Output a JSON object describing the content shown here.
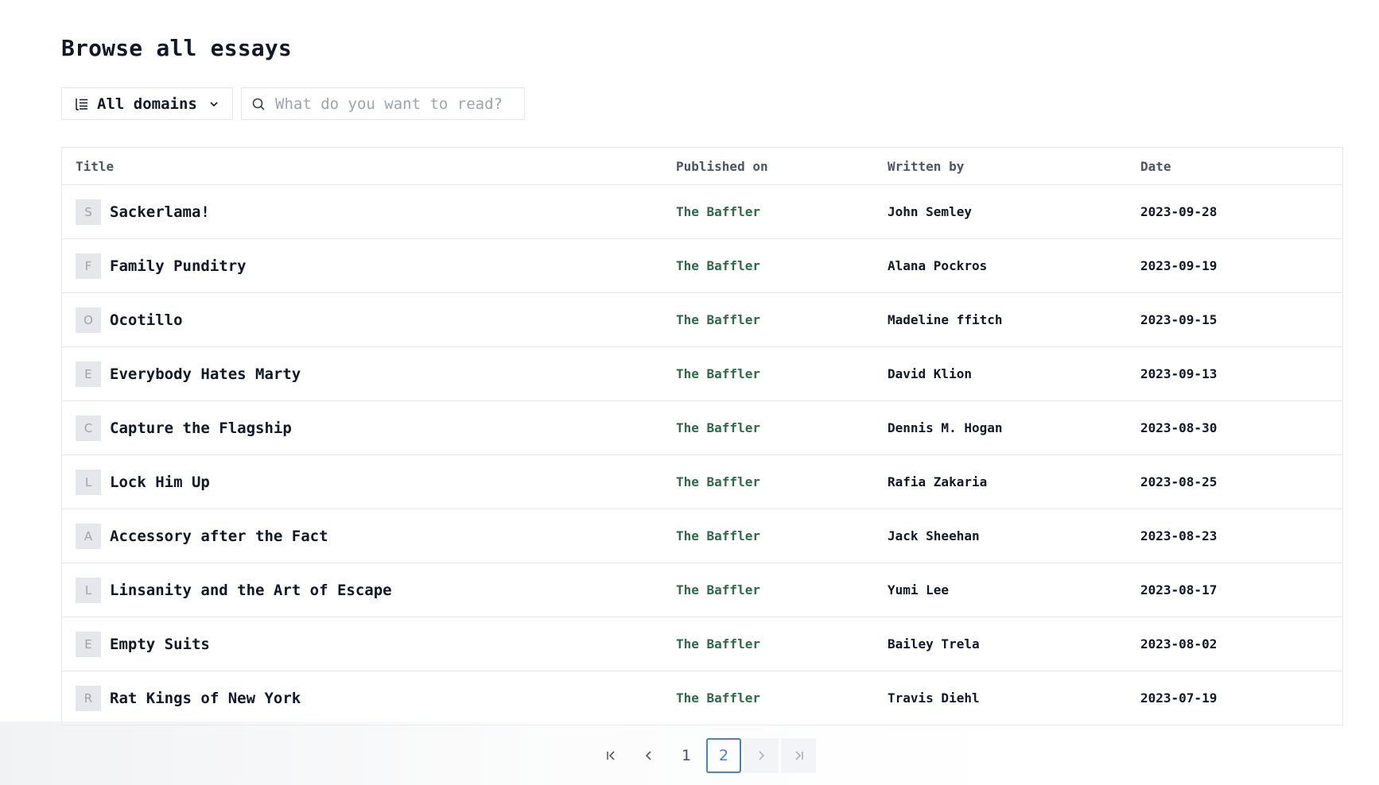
{
  "page": {
    "title": "Browse all essays"
  },
  "filters": {
    "domain_label": "All domains",
    "search_placeholder": "What do you want to read?",
    "search_value": ""
  },
  "table": {
    "columns": [
      "Title",
      "Published on",
      "Written by",
      "Date"
    ],
    "rows": [
      {
        "initial": "S",
        "title": "Sackerlama!",
        "published_on": "The Baffler",
        "author": "John Semley",
        "date": "2023-09-28"
      },
      {
        "initial": "F",
        "title": "Family Punditry",
        "published_on": "The Baffler",
        "author": "Alana Pockros",
        "date": "2023-09-19"
      },
      {
        "initial": "O",
        "title": "Ocotillo",
        "published_on": "The Baffler",
        "author": "Madeline ffitch",
        "date": "2023-09-15"
      },
      {
        "initial": "E",
        "title": "Everybody Hates Marty",
        "published_on": "The Baffler",
        "author": "David Klion",
        "date": "2023-09-13"
      },
      {
        "initial": "C",
        "title": "Capture the Flagship",
        "published_on": "The Baffler",
        "author": "Dennis M. Hogan",
        "date": "2023-08-30"
      },
      {
        "initial": "L",
        "title": "Lock Him Up",
        "published_on": "The Baffler",
        "author": "Rafia Zakaria",
        "date": "2023-08-25"
      },
      {
        "initial": "A",
        "title": "Accessory after the Fact",
        "published_on": "The Baffler",
        "author": "Jack Sheehan",
        "date": "2023-08-23"
      },
      {
        "initial": "L",
        "title": "Linsanity and the Art of Escape",
        "published_on": "The Baffler",
        "author": "Yumi Lee",
        "date": "2023-08-17"
      },
      {
        "initial": "E",
        "title": "Empty Suits",
        "published_on": "The Baffler",
        "author": "Bailey Trela",
        "date": "2023-08-02"
      },
      {
        "initial": "R",
        "title": "Rat Kings of New York",
        "published_on": "The Baffler",
        "author": "Travis Diehl",
        "date": "2023-07-19"
      }
    ]
  },
  "pagination": {
    "pages": [
      "1",
      "2"
    ],
    "current": "2",
    "first_icon": "first-page-icon",
    "prev_icon": "chevron-left-icon",
    "next_icon": "chevron-right-icon",
    "last_icon": "last-page-icon"
  },
  "colors": {
    "link": "#2e6a4a",
    "active_page": "#1e5fa8",
    "border": "#e5e7eb"
  }
}
